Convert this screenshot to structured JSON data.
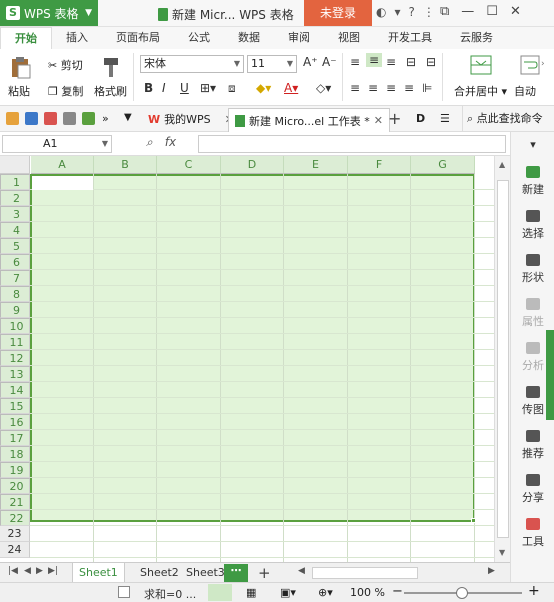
{
  "app": {
    "name": "WPS 表格",
    "doc_title": "新建 Micr... WPS 表格",
    "login": "未登录"
  },
  "tabs": [
    "开始",
    "插入",
    "页面布局",
    "公式",
    "数据",
    "审阅",
    "视图",
    "开发工具",
    "云服务"
  ],
  "ribbon": {
    "paste": "粘贴",
    "cut": "剪切",
    "copy": "复制",
    "format_painter": "格式刷",
    "font_name": "宋体",
    "font_size": "11",
    "merge_center": "合并居中",
    "auto_wrap": "自动"
  },
  "doc_tabs": {
    "my_wps": "我的WPS",
    "current": "新建 Micro...el 工作表 *"
  },
  "find_command": "点此查找命令",
  "formula_bar": {
    "cell_ref": "A1",
    "fx": "fx"
  },
  "columns": [
    "A",
    "B",
    "C",
    "D",
    "E",
    "F",
    "G"
  ],
  "rows": [
    "1",
    "2",
    "3",
    "4",
    "5",
    "6",
    "7",
    "8",
    "9",
    "10",
    "11",
    "12",
    "13",
    "14",
    "15",
    "16",
    "17",
    "18",
    "19",
    "20",
    "21",
    "22",
    "23",
    "24"
  ],
  "right_pane": [
    {
      "label": "新建",
      "enabled": true
    },
    {
      "label": "选择",
      "enabled": true
    },
    {
      "label": "形状",
      "enabled": true
    },
    {
      "label": "属性",
      "enabled": false
    },
    {
      "label": "分析",
      "enabled": false
    },
    {
      "label": "传图",
      "enabled": true
    },
    {
      "label": "推荐",
      "enabled": true
    },
    {
      "label": "分享",
      "enabled": true
    },
    {
      "label": "工具",
      "enabled": true
    }
  ],
  "sheets": [
    "Sheet1",
    "Sheet2",
    "Sheet3"
  ],
  "status": {
    "sum": "求和=0 ...",
    "zoom": "100 %"
  },
  "colors": {
    "accent": "#3f9a44",
    "selection_fill": "#e2f4d9",
    "login": "#e3643f"
  }
}
